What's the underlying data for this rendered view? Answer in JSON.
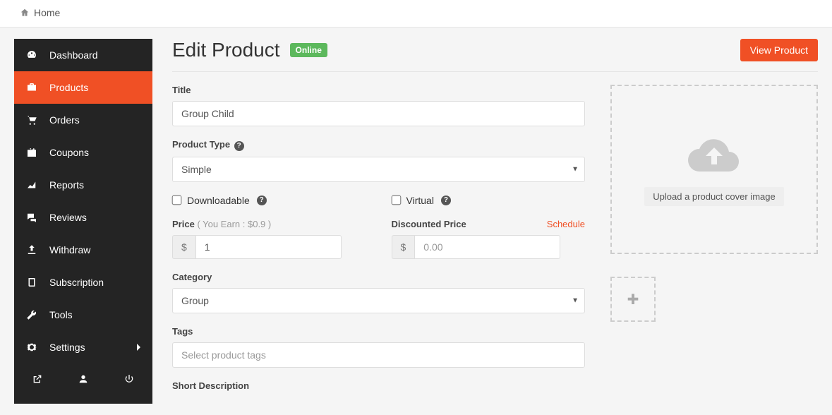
{
  "breadcrumb": {
    "home": "Home"
  },
  "sidebar": {
    "items": [
      {
        "label": "Dashboard"
      },
      {
        "label": "Products"
      },
      {
        "label": "Orders"
      },
      {
        "label": "Coupons"
      },
      {
        "label": "Reports"
      },
      {
        "label": "Reviews"
      },
      {
        "label": "Withdraw"
      },
      {
        "label": "Subscription"
      },
      {
        "label": "Tools"
      },
      {
        "label": "Settings"
      }
    ]
  },
  "header": {
    "title": "Edit Product",
    "status": "Online",
    "view_button": "View Product"
  },
  "form": {
    "title_label": "Title",
    "title_value": "Group Child",
    "product_type_label": "Product Type",
    "product_type_value": "Simple",
    "downloadable_label": "Downloadable",
    "virtual_label": "Virtual",
    "price_label": "Price",
    "price_sub": "( You Earn : $0.9 )",
    "price_currency": "$",
    "price_value": "1",
    "discounted_label": "Discounted Price",
    "discounted_placeholder": "0.00",
    "schedule": "Schedule",
    "category_label": "Category",
    "category_value": "Group",
    "tags_label": "Tags",
    "tags_placeholder": "Select product tags",
    "short_desc_label": "Short Description"
  },
  "upload": {
    "text": "Upload a product cover image"
  }
}
